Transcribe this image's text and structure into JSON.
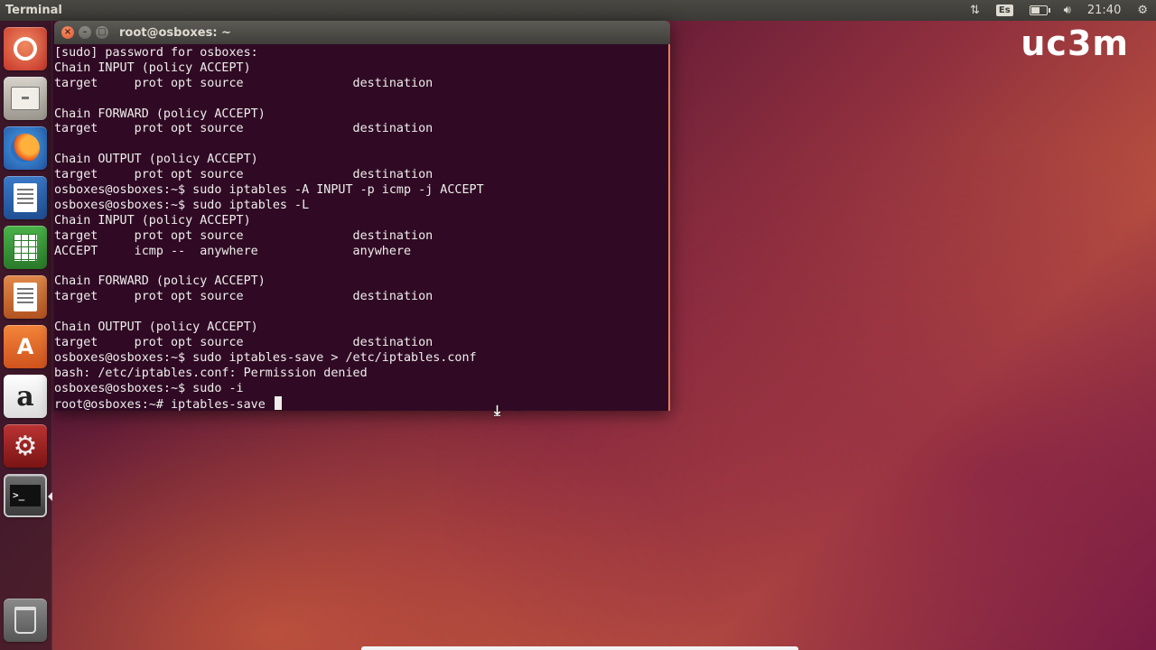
{
  "top_panel": {
    "app_title": "Terminal",
    "keyboard_layout": "Es",
    "clock": "21:40",
    "icons": [
      "network-icon",
      "keyboard-layout-icon",
      "battery-icon",
      "volume-icon",
      "gear-icon"
    ]
  },
  "launcher": {
    "items": [
      {
        "name": "ubuntu-dash",
        "icon": "ubuntu-logo-icon"
      },
      {
        "name": "files",
        "icon": "file-cabinet-icon"
      },
      {
        "name": "firefox",
        "icon": "firefox-icon"
      },
      {
        "name": "libreoffice-writer",
        "icon": "writer-document-icon"
      },
      {
        "name": "libreoffice-calc",
        "icon": "calc-spreadsheet-icon"
      },
      {
        "name": "libreoffice-impress",
        "icon": "impress-presentation-icon"
      },
      {
        "name": "ubuntu-software-center",
        "icon": "shopping-bag-icon"
      },
      {
        "name": "amazon",
        "icon": "amazon-icon"
      },
      {
        "name": "system-settings",
        "icon": "settings-gear-icon"
      },
      {
        "name": "terminal",
        "icon": "terminal-icon",
        "active": true
      },
      {
        "name": "trash",
        "icon": "trash-icon"
      }
    ],
    "glyphs": {
      "amazon": "a",
      "software": "A",
      "settings": "⚙",
      "terminal": ">_"
    }
  },
  "terminal": {
    "title": "root@osboxes: ~",
    "buttons": {
      "close": "×",
      "minimize": "–",
      "maximize": "□"
    },
    "lines": [
      "[sudo] password for osboxes:",
      "Chain INPUT (policy ACCEPT)",
      "target     prot opt source               destination",
      "",
      "Chain FORWARD (policy ACCEPT)",
      "target     prot opt source               destination",
      "",
      "Chain OUTPUT (policy ACCEPT)",
      "target     prot opt source               destination",
      "osboxes@osboxes:~$ sudo iptables -A INPUT -p icmp -j ACCEPT",
      "osboxes@osboxes:~$ sudo iptables -L",
      "Chain INPUT (policy ACCEPT)",
      "target     prot opt source               destination",
      "ACCEPT     icmp --  anywhere             anywhere",
      "",
      "Chain FORWARD (policy ACCEPT)",
      "target     prot opt source               destination",
      "",
      "Chain OUTPUT (policy ACCEPT)",
      "target     prot opt source               destination",
      "osboxes@osboxes:~$ sudo iptables-save > /etc/iptables.conf",
      "bash: /etc/iptables.conf: Permission denied",
      "osboxes@osboxes:~$ sudo -i",
      "root@osboxes:~# iptables-save "
    ]
  },
  "brand": {
    "logo_text": "uc3m"
  },
  "desktop": {
    "mouse_cursor_glyph": "⤓"
  },
  "colors": {
    "terminal_bg": "#300a24",
    "terminal_fg": "#eeeeec",
    "accent_orange": "#e87a53"
  }
}
